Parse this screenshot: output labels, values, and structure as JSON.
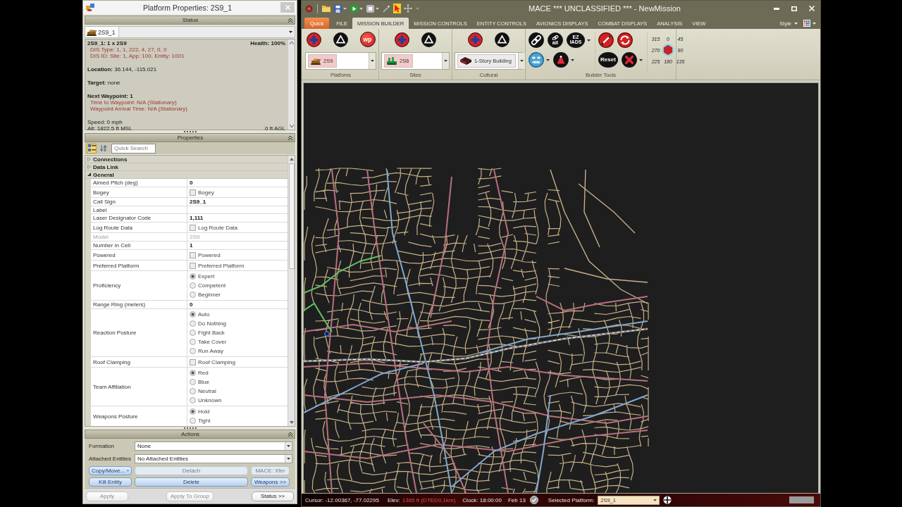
{
  "properties_window": {
    "title": "Platform Properties: 2S9_1",
    "status": {
      "header": "Status",
      "entity": "2S9_1",
      "blocks": [
        {
          "lines": [
            {
              "kind": "heading",
              "text": "2S9_1: 1 x 2S9",
              "right": "Health: 100%"
            },
            {
              "kind": "detail",
              "text": "DIS Type: 1, 1, 222, 4, 27, 0, 0"
            },
            {
              "kind": "detail",
              "text": "DIS ID: Site: 1, App: 100, Entity: 1001"
            }
          ]
        },
        {
          "lines": [
            {
              "kind": "field",
              "text": "**Location:** 36.144, -115.021"
            }
          ]
        },
        {
          "lines": [
            {
              "kind": "field",
              "text": "**Target:** none"
            }
          ]
        },
        {
          "lines": [
            {
              "kind": "heading",
              "text": "Next Waypoint: 1"
            },
            {
              "kind": "detail",
              "text": "Time to Waypoint: N/A (Stationary)"
            },
            {
              "kind": "detail",
              "text": "Waypoint Arrival Time: N/A (Stationary)"
            }
          ]
        },
        {
          "lines": [
            {
              "kind": "field",
              "text": "Speed: 0 mph"
            },
            {
              "kind": "field",
              "text": "Alt: 1822.5 ft MSL",
              "right": "0 ft AGL"
            }
          ]
        }
      ]
    },
    "properties": {
      "header": "Properties",
      "view_modes": [
        {
          "kind": "categorized",
          "selected": true
        },
        {
          "kind": "alphabetical",
          "selected": false
        }
      ],
      "search": {
        "placeholder": "Quick Search"
      },
      "categories": [
        {
          "name": "Connections",
          "expanded": false
        },
        {
          "name": "Data Link",
          "expanded": false
        },
        {
          "name": "General",
          "expanded": true,
          "rows": [
            {
              "label": "Aimed Pitch (deg)",
              "kind": "text",
              "value": "0",
              "disabled": false
            },
            {
              "label": "Bogey",
              "kind": "checkbox",
              "text": "Bogey",
              "checked": false,
              "disabled": false
            },
            {
              "label": "Call Sign",
              "kind": "text",
              "value": "2S9_1",
              "disabled": false
            },
            {
              "label": "Label",
              "kind": "text",
              "disabled": false
            },
            {
              "label": "Laser Designator Code",
              "kind": "text",
              "value": "1,111",
              "disabled": false
            },
            {
              "label": "Log Route Data",
              "kind": "checkbox",
              "text": "Log Route Data",
              "checked": false,
              "disabled": false
            },
            {
              "label": "Model",
              "kind": "text",
              "value": "2S9",
              "disabled": true
            },
            {
              "label": "Number in Cell",
              "kind": "text",
              "value": "1",
              "disabled": false
            },
            {
              "label": "Powered",
              "kind": "checkbox",
              "text": "Powered",
              "checked": false,
              "disabled": false
            },
            {
              "label": "Preferred Platform",
              "kind": "checkbox",
              "text": "Preferred Platform",
              "checked": false,
              "disabled": false
            },
            {
              "label": "Proficiency",
              "kind": "radio",
              "disabled": false,
              "options": [
                {
                  "label": "Expert",
                  "selected": true
                },
                {
                  "label": "Competent",
                  "selected": false
                },
                {
                  "label": "Beginner",
                  "selected": false
                }
              ]
            },
            {
              "label": "Range Ring (meters)",
              "kind": "text",
              "value": "0",
              "disabled": false
            },
            {
              "label": "Reaction Posture",
              "kind": "radio",
              "disabled": false,
              "options": [
                {
                  "label": "Auto",
                  "selected": true
                },
                {
                  "label": "Do Nothing",
                  "selected": false
                },
                {
                  "label": "Fight Back",
                  "selected": false
                },
                {
                  "label": "Take Cover",
                  "selected": false
                },
                {
                  "label": "Run Away",
                  "selected": false
                }
              ]
            },
            {
              "label": "Roof Clamping",
              "kind": "checkbox",
              "text": "Roof Clamping",
              "checked": false,
              "disabled": false
            },
            {
              "label": "Team Affiliation",
              "kind": "radio",
              "disabled": false,
              "options": [
                {
                  "label": "Red",
                  "selected": true
                },
                {
                  "label": "Blue",
                  "selected": false
                },
                {
                  "label": "Neutral",
                  "selected": false
                },
                {
                  "label": "Unknown",
                  "selected": false
                }
              ]
            },
            {
              "label": "Weapons Posture",
              "kind": "radio",
              "disabled": false,
              "options": [
                {
                  "label": "Hold",
                  "selected": true
                },
                {
                  "label": "Tight",
                  "selected": false
                }
              ]
            }
          ]
        }
      ]
    },
    "actions": {
      "header": "Actions",
      "fields": [
        {
          "label": "Formation",
          "value": "None"
        },
        {
          "label": "Attached Entities",
          "value": "No Attached Entities"
        }
      ],
      "buttons": [
        {
          "label": "Copy/Move...",
          "disabled": false,
          "dropdown": true
        },
        {
          "label": "Detach",
          "disabled": true,
          "dropdown": false
        },
        {
          "label": "MACE: Xfer",
          "disabled": true,
          "dropdown": false
        },
        {
          "label": "Kill Entity",
          "disabled": false,
          "dropdown": false
        },
        {
          "label": "Delete",
          "disabled": false,
          "dropdown": false
        },
        {
          "label": "Weapons >>",
          "disabled": false,
          "dropdown": false
        }
      ],
      "footer": [
        {
          "label": "Apply",
          "disabled": true
        },
        {
          "label": "Apply To Group",
          "disabled": true
        },
        {
          "label": "Status >>",
          "disabled": false
        }
      ]
    }
  },
  "main_window": {
    "title": "MACE *** UNCLASSIFIED *** - NewMission",
    "quick_access": [
      {
        "kind": "app",
        "dropdown": false,
        "selected": false
      },
      {
        "kind": "folder",
        "dropdown": false,
        "selected": false
      },
      {
        "kind": "save",
        "dropdown": true,
        "selected": false
      },
      {
        "kind": "play",
        "dropdown": true,
        "selected": false
      },
      {
        "kind": "stop",
        "dropdown": true,
        "selected": false
      },
      {
        "kind": "wand",
        "dropdown": false,
        "selected": false
      },
      {
        "kind": "pointer",
        "dropdown": false,
        "selected": true
      },
      {
        "kind": "move",
        "dropdown": false,
        "selected": false
      },
      {
        "kind": "customize",
        "dropdown": false,
        "selected": false
      }
    ],
    "quick_button": "Quick",
    "tabs": [
      {
        "label": "FILE",
        "selected": false
      },
      {
        "label": "MISSION BUILDER",
        "selected": true
      },
      {
        "label": "MISSION CONTROLS",
        "selected": false
      },
      {
        "label": "ENTITY CONTROLS",
        "selected": false
      },
      {
        "label": "AVIONICS DISPLAYS",
        "selected": false
      },
      {
        "label": "COMBAT DISPLAYS",
        "selected": false
      },
      {
        "label": "ANALYSIS",
        "selected": false
      },
      {
        "label": "VIEW",
        "selected": false
      }
    ],
    "style_menu": "Style",
    "ribbon": {
      "groups": [
        {
          "label": "Platfoms",
          "tools": [
            {
              "kind": "add"
            },
            {
              "kind": "triangle"
            },
            {
              "kind": "wp",
              "text": "wp"
            }
          ],
          "combo": {
            "kind": "vehicle",
            "value": "2S9",
            "color": "#f4c9c9"
          }
        },
        {
          "label": "Sites",
          "tools": [
            {
              "kind": "add"
            },
            {
              "kind": "triangle"
            }
          ],
          "combo": {
            "kind": "site",
            "value": "2S6",
            "color": "#f4c9c9"
          }
        },
        {
          "label": "Cultural",
          "tools": [
            {
              "kind": "add"
            },
            {
              "kind": "triangle"
            }
          ],
          "combo": {
            "kind": "building",
            "value": "1-Story Building",
            "color": "#ebebeb"
          }
        }
      ],
      "builder_tools": {
        "label": "Builder Tools",
        "columns": [
          {
            "top": [
              {
                "kind": "link",
                "dropdown": false
              },
              {
                "kind": "link_all",
                "text": "all",
                "dropdown": false
              },
              {
                "kind": "ez_iads",
                "text": "EZ IADS",
                "dropdown": true
              }
            ],
            "bottom": [
              {
                "kind": "face",
                "dropdown": true
              },
              {
                "kind": "cone",
                "dropdown": true
              }
            ]
          },
          {
            "top": [
              {
                "kind": "line",
                "dropdown": false
              },
              {
                "kind": "refresh",
                "dropdown": false
              }
            ],
            "bottom": [
              {
                "kind": "reset",
                "text": "Reset",
                "dropdown": false
              },
              {
                "kind": "delete",
                "dropdown": true
              }
            ]
          }
        ],
        "compass": [
          "315",
          "0",
          "45",
          "270",
          "90",
          "225",
          "180",
          "135"
        ]
      }
    },
    "status_bar": {
      "cursor": "Cursor: -12.00367, -77.02295",
      "elev_label": "Elev:",
      "elev_value": "1365 ft (DTED0,1km)",
      "clock": "Clock: 18:00:00",
      "date": "Feb 13",
      "platform_label": "Selected Platform:",
      "platform": "2S9_1"
    }
  }
}
